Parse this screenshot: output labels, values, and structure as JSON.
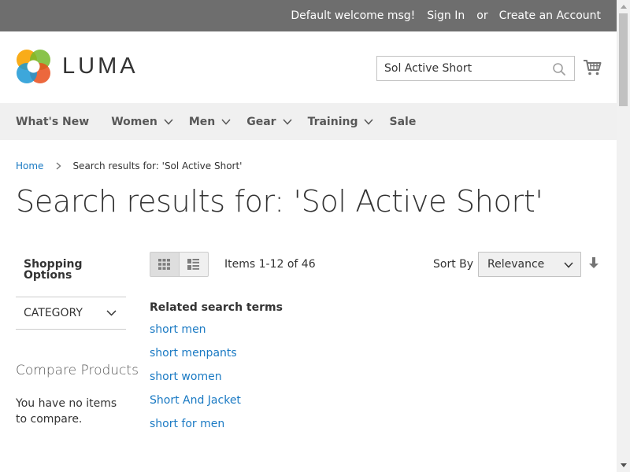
{
  "topbar": {
    "welcome": "Default welcome msg!",
    "sign_in": "Sign In",
    "or": "or",
    "create_account": "Create an Account"
  },
  "header": {
    "logo_text": "LUMA",
    "search_value": "Sol Active Short",
    "cart_icon": "cart-icon"
  },
  "nav": {
    "items": [
      {
        "label": "What's New",
        "has_chevron": false
      },
      {
        "label": "Women",
        "has_chevron": true
      },
      {
        "label": "Men",
        "has_chevron": true
      },
      {
        "label": "Gear",
        "has_chevron": true
      },
      {
        "label": "Training",
        "has_chevron": true
      },
      {
        "label": "Sale",
        "has_chevron": false
      }
    ]
  },
  "breadcrumb": {
    "home": "Home",
    "current": "Search results for: 'Sol Active Short'"
  },
  "page_title": "Search results for: 'Sol Active Short'",
  "sidebar": {
    "shopping_options_title": "Shopping Options",
    "category_label": "CATEGORY",
    "compare_title": "Compare Products",
    "compare_text": "You have no items to compare."
  },
  "toolbar": {
    "items_count": "Items 1-12 of 46",
    "sort_by_label": "Sort By",
    "sort_value": "Relevance",
    "view_modes": [
      "grid",
      "list"
    ],
    "active_view_mode": "grid"
  },
  "related": {
    "title": "Related search terms",
    "terms": [
      "short men",
      "short menpants",
      "short women",
      "Short And Jacket",
      "short for men"
    ]
  },
  "colors": {
    "topbar_bg": "#6e6e6e",
    "nav_bg": "#f0f0f0",
    "link": "#1979c3",
    "text": "#333333"
  }
}
